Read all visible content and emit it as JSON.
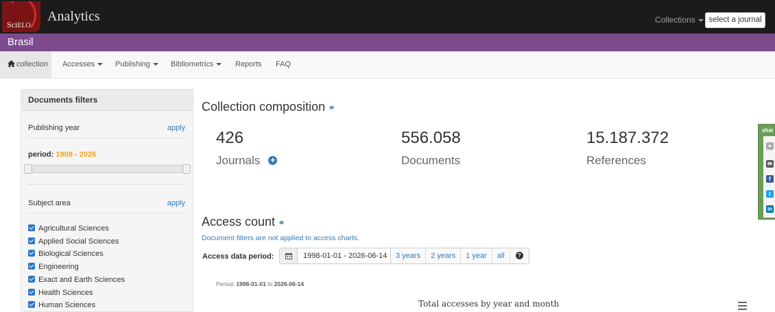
{
  "topbar": {
    "logo_text_big": "Sci",
    "logo_text_small": "ELO",
    "brand": "Analytics",
    "collections_label": "Collections",
    "select_journal_label": "select a journal"
  },
  "collection": {
    "name": "Brasil"
  },
  "nav": {
    "items": [
      "collection",
      "Accesses",
      "Publishing",
      "Bibliometrics",
      "Reports",
      "FAQ"
    ]
  },
  "filters": {
    "title": "Documents filters",
    "publishing_year_label": "Publishing year",
    "apply_label": "apply",
    "period_label": "period:",
    "period_range": "1909 - 2026",
    "subject_area_label": "Subject area",
    "subjects": [
      "Agricultural Sciences",
      "Applied Social Sciences",
      "Biological Sciences",
      "Engineering",
      "Exact and Earth Sciences",
      "Health Sciences",
      "Human Sciences"
    ]
  },
  "composition": {
    "title": "Collection composition",
    "journals_value": "426",
    "journals_label": "Journals",
    "documents_value": "556.058",
    "documents_label": "Documents",
    "references_value": "15.187.372",
    "references_label": "References"
  },
  "access": {
    "title": "Access count",
    "note": "Document filters are not applied to access charts.",
    "period_label": "Access data period:",
    "date_range": "1998-01-01 - 2026-06-14",
    "buttons": [
      "3 years",
      "2 years",
      "1 year",
      "all"
    ],
    "period_prefix": "Period:",
    "period_start": "1998-01-01",
    "period_to": "to",
    "period_end": "2026-06-14",
    "chart_title": "Total accesses by year and month"
  },
  "share": {
    "label": "shar",
    "icons": [
      "link-icon",
      "email-icon",
      "facebook-icon",
      "twitter-icon",
      "linkedin-icon"
    ],
    "colors": [
      "#aaaaaa",
      "#555555",
      "#3b5998",
      "#1da1f2",
      "#0077b5"
    ]
  }
}
